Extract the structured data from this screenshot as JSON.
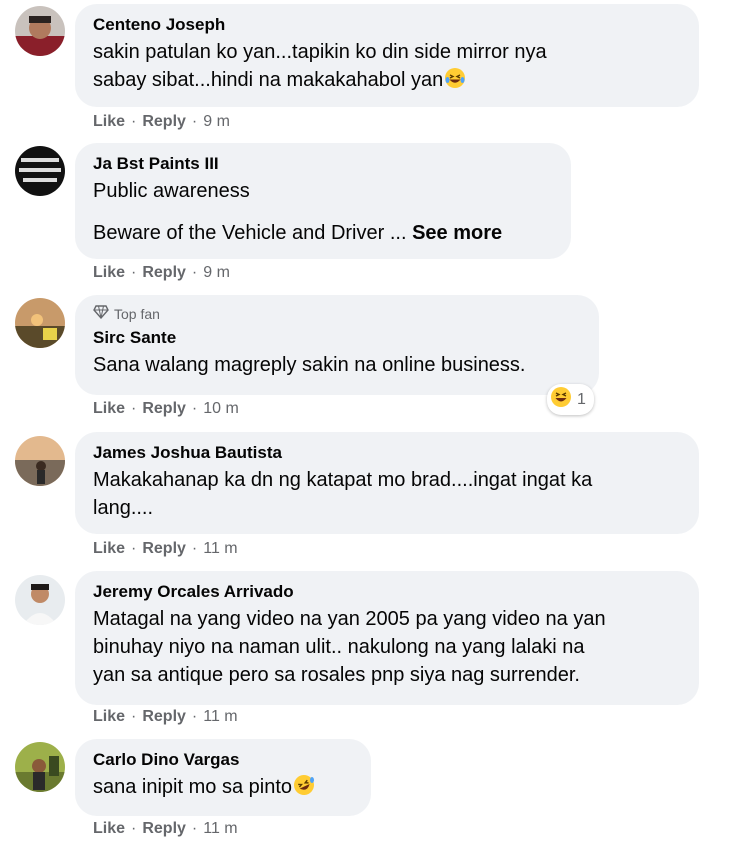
{
  "comments": [
    {
      "author": "Centeno Joseph",
      "lines": [
        "sakin patulan ko yan...tapikin ko din side mirror nya",
        "sabay sibat...hindi na makakahabol yan"
      ],
      "emoji": "laughing-tears-emoji",
      "like": "Like",
      "reply": "Reply",
      "time": "9 m"
    },
    {
      "author": "Ja Bst Paints III",
      "line1": "Public awareness",
      "line2": "Beware of the Vehicle and Driver ...",
      "see_more": "See more",
      "like": "Like",
      "reply": "Reply",
      "time": "9 m"
    },
    {
      "badge": "Top fan",
      "author": "Sirc Sante",
      "text": "Sana walang magreply sakin na online business.",
      "reaction_count": "1",
      "reaction_icon": "haha-reaction-icon",
      "like": "Like",
      "reply": "Reply",
      "time": "10 m"
    },
    {
      "author": "James Joshua Bautista",
      "lines": [
        "Makakahanap ka dn ng katapat mo brad....ingat ingat ka",
        "lang...."
      ],
      "like": "Like",
      "reply": "Reply",
      "time": "11 m"
    },
    {
      "author": "Jeremy Orcales Arrivado",
      "lines": [
        "Matagal na yang video na yan 2005 pa yang video na yan",
        "binuhay niyo na naman ulit.. nakulong na yang lalaki na",
        "yan sa antique pero sa rosales pnp siya nag surrender."
      ],
      "like": "Like",
      "reply": "Reply",
      "time": "11 m"
    },
    {
      "author": "Carlo Dino Vargas",
      "text": "sana inipit mo sa pinto",
      "emoji": "rolling-laughing-emoji",
      "like": "Like",
      "reply": "Reply",
      "time": "11 m"
    }
  ],
  "separator": "·"
}
